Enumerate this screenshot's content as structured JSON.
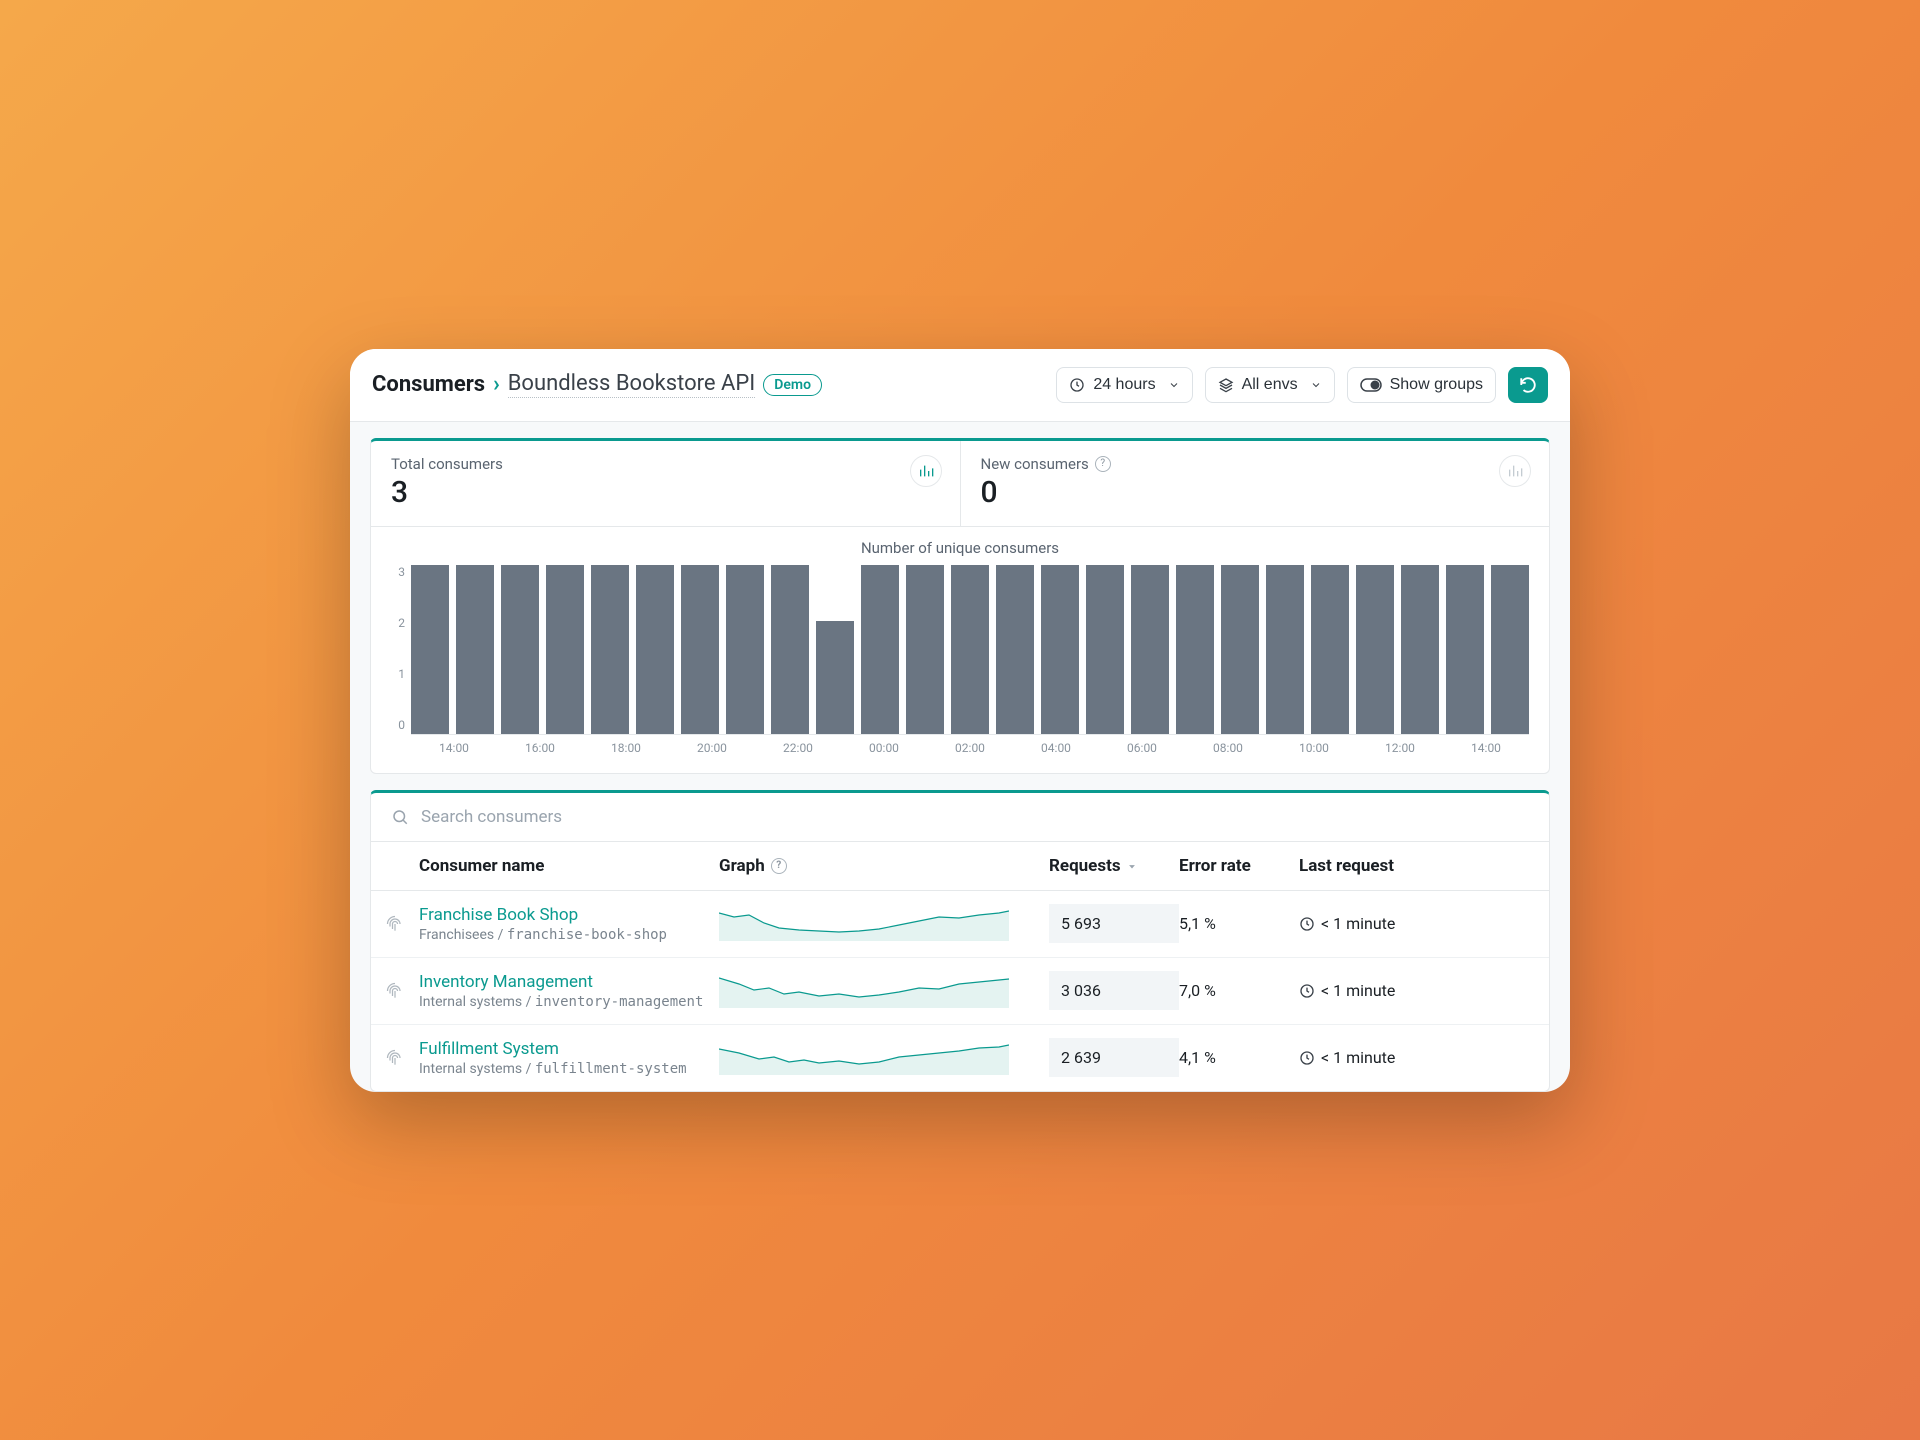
{
  "breadcrumb": {
    "root": "Consumers",
    "api": "Boundless Bookstore API",
    "badge": "Demo"
  },
  "toolbar": {
    "timerange": "24 hours",
    "envs": "All envs",
    "groups": "Show groups"
  },
  "stats": {
    "total_label": "Total consumers",
    "total_value": "3",
    "new_label": "New consumers",
    "new_value": "0"
  },
  "chart_data": {
    "type": "bar",
    "title": "Number of unique consumers",
    "ylabel": "",
    "ylim": [
      0,
      3
    ],
    "y_ticks": [
      "3",
      "2",
      "1",
      "0"
    ],
    "categories": [
      "14:00",
      "15:00",
      "16:00",
      "17:00",
      "18:00",
      "19:00",
      "20:00",
      "21:00",
      "22:00",
      "23:00",
      "00:00",
      "01:00",
      "02:00",
      "03:00",
      "04:00",
      "05:00",
      "06:00",
      "07:00",
      "08:00",
      "09:00",
      "10:00",
      "11:00",
      "12:00",
      "13:00",
      "14:00"
    ],
    "x_tick_labels": [
      "14:00",
      "16:00",
      "18:00",
      "20:00",
      "22:00",
      "00:00",
      "02:00",
      "04:00",
      "06:00",
      "08:00",
      "10:00",
      "12:00",
      "14:00"
    ],
    "values": [
      3,
      3,
      3,
      3,
      3,
      3,
      3,
      3,
      3,
      2,
      3,
      3,
      3,
      3,
      3,
      3,
      3,
      3,
      3,
      3,
      3,
      3,
      3,
      3,
      3
    ]
  },
  "search": {
    "placeholder": "Search consumers"
  },
  "table": {
    "columns": {
      "name": "Consumer name",
      "graph": "Graph",
      "requests": "Requests",
      "error": "Error rate",
      "last": "Last request"
    },
    "rows": [
      {
        "name": "Franchise Book Shop",
        "group": "Franchisees",
        "slug": "franchise-book-shop",
        "requests": "5 693",
        "error": "5,1  %",
        "last": "< 1 minute"
      },
      {
        "name": "Inventory Management",
        "group": "Internal systems",
        "slug": "inventory-management",
        "requests": "3 036",
        "error": "7,0  %",
        "last": "< 1 minute"
      },
      {
        "name": "Fulfillment System",
        "group": "Internal systems",
        "slug": "fulfillment-system",
        "requests": "2 639",
        "error": "4,1  %",
        "last": "< 1 minute"
      }
    ]
  }
}
